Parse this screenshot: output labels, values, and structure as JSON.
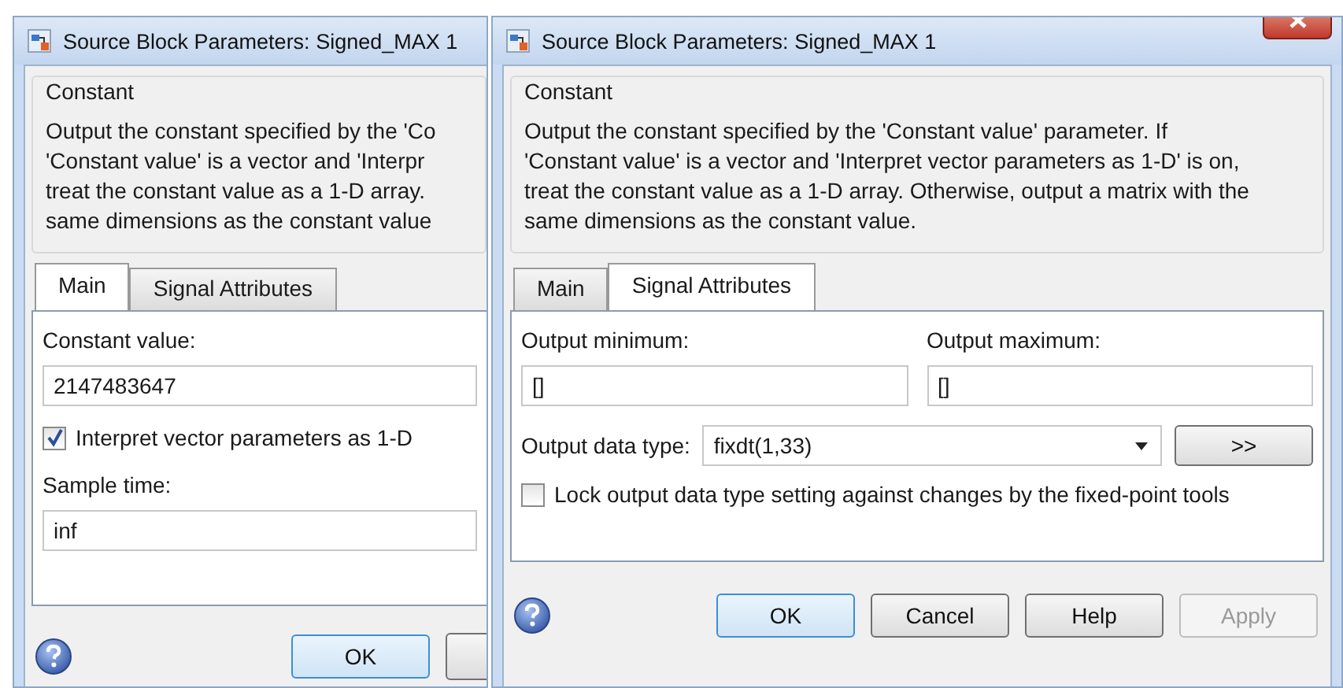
{
  "windows": [
    {
      "title": "Source Block Parameters: Signed_MAX 1",
      "group_title": "Constant",
      "description_lines": [
        "Output the constant specified by the 'Co",
        "'Constant value' is a vector and 'Interpr",
        "treat the constant value as a 1-D array.",
        "same dimensions as the constant value"
      ],
      "tabs": [
        {
          "label": "Main",
          "selected": true
        },
        {
          "label": "Signal Attributes",
          "selected": false
        }
      ],
      "fields": [
        {
          "kind": "label",
          "text": "Constant value:"
        },
        {
          "kind": "input",
          "value": "2147483647"
        },
        {
          "kind": "checkbox",
          "label": "Interpret vector parameters as 1-D",
          "checked": true
        },
        {
          "kind": "label",
          "text": "Sample time:"
        },
        {
          "kind": "input",
          "value": "inf"
        }
      ],
      "buttons": [
        {
          "kind": "button",
          "label": "OK",
          "default": true,
          "disabled": false
        },
        {
          "kind": "partial"
        }
      ]
    },
    {
      "title": "Source Block Parameters: Signed_MAX 1",
      "closable": true,
      "group_title": "Constant",
      "description_lines": [
        "Output the constant specified by the 'Constant value' parameter. If",
        "'Constant value' is a vector and 'Interpret vector parameters as 1-D' is on,",
        "treat the constant value as a 1-D array. Otherwise, output a matrix with the",
        "same dimensions as the constant value."
      ],
      "tabs": [
        {
          "label": "Main",
          "selected": false
        },
        {
          "label": "Signal Attributes",
          "selected": true
        }
      ],
      "fields": [
        {
          "kind": "pair",
          "items": [
            {
              "label": "Output minimum:",
              "value": "[]"
            },
            {
              "label": "Output maximum:",
              "value": "[]"
            }
          ]
        },
        {
          "kind": "select",
          "label": "Output data type:",
          "value": "fixdt(1,33)",
          "button": ">>"
        },
        {
          "kind": "checkbox",
          "label": "Lock output data type setting against changes by the fixed-point tools",
          "checked": false
        }
      ],
      "buttons": [
        {
          "kind": "button",
          "label": "OK",
          "default": true,
          "disabled": false
        },
        {
          "kind": "button",
          "label": "Cancel",
          "default": false,
          "disabled": false
        },
        {
          "kind": "button",
          "label": "Help",
          "default": false,
          "disabled": false
        },
        {
          "kind": "button",
          "label": "Apply",
          "default": false,
          "disabled": true
        }
      ]
    }
  ]
}
